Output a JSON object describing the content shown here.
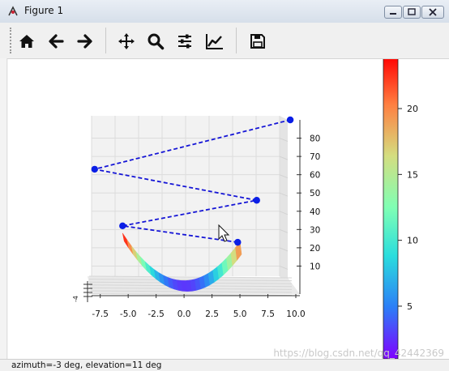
{
  "window": {
    "title": "Figure 1",
    "controls": [
      "minimize",
      "maximize",
      "close"
    ]
  },
  "toolbar": {
    "buttons": [
      {
        "name": "home",
        "icon": "home-icon"
      },
      {
        "name": "back",
        "icon": "arrow-left-icon"
      },
      {
        "name": "forward",
        "icon": "arrow-right-icon"
      },
      {
        "name": "pan",
        "icon": "move-icon"
      },
      {
        "name": "zoom",
        "icon": "magnifier-icon"
      },
      {
        "name": "configure-subplots",
        "icon": "sliders-icon"
      },
      {
        "name": "edit-axes",
        "icon": "line-chart-icon"
      },
      {
        "name": "save",
        "icon": "floppy-icon"
      }
    ]
  },
  "status": {
    "text": "azimuth=-3 deg, elevation=11 deg",
    "watermark": "https://blog.csdn.net/qq_42442369"
  },
  "plot": {
    "x_ticks": [
      "-7.5",
      "-5.0",
      "-2.5",
      "0.0",
      "2.5",
      "5.0",
      "7.5",
      "10.0"
    ],
    "z_ticks": [
      "10",
      "20",
      "30",
      "40",
      "50",
      "60",
      "70",
      "80"
    ],
    "colorbar_ticks": [
      "5",
      "10",
      "15",
      "20"
    ],
    "line_color": "#1515d6",
    "marker_color": "#0a1ee6",
    "colormap": "rainbow"
  },
  "chart_data": {
    "type": "line",
    "title": "",
    "view": {
      "azimuth_deg": -3,
      "elevation_deg": 11
    },
    "x_range": [
      -9,
      10
    ],
    "z_range": [
      0,
      90
    ],
    "series": [
      {
        "style": "dashed line with circle markers",
        "points": [
          {
            "x": 4.8,
            "z": 23
          },
          {
            "x": -5.5,
            "z": 32
          },
          {
            "x": 6.5,
            "z": 46
          },
          {
            "x": -8.0,
            "z": 63
          },
          {
            "x": 9.5,
            "z": 90
          }
        ]
      }
    ],
    "surface": {
      "description": "parabolic trough colored by rainbow colormap",
      "x_extent": [
        -5.5,
        5
      ],
      "z_extent": [
        0,
        28
      ]
    },
    "colorbar": {
      "range": [
        1,
        24
      ],
      "ticks": [
        5,
        10,
        15,
        20
      ],
      "colormap": "rainbow"
    }
  }
}
